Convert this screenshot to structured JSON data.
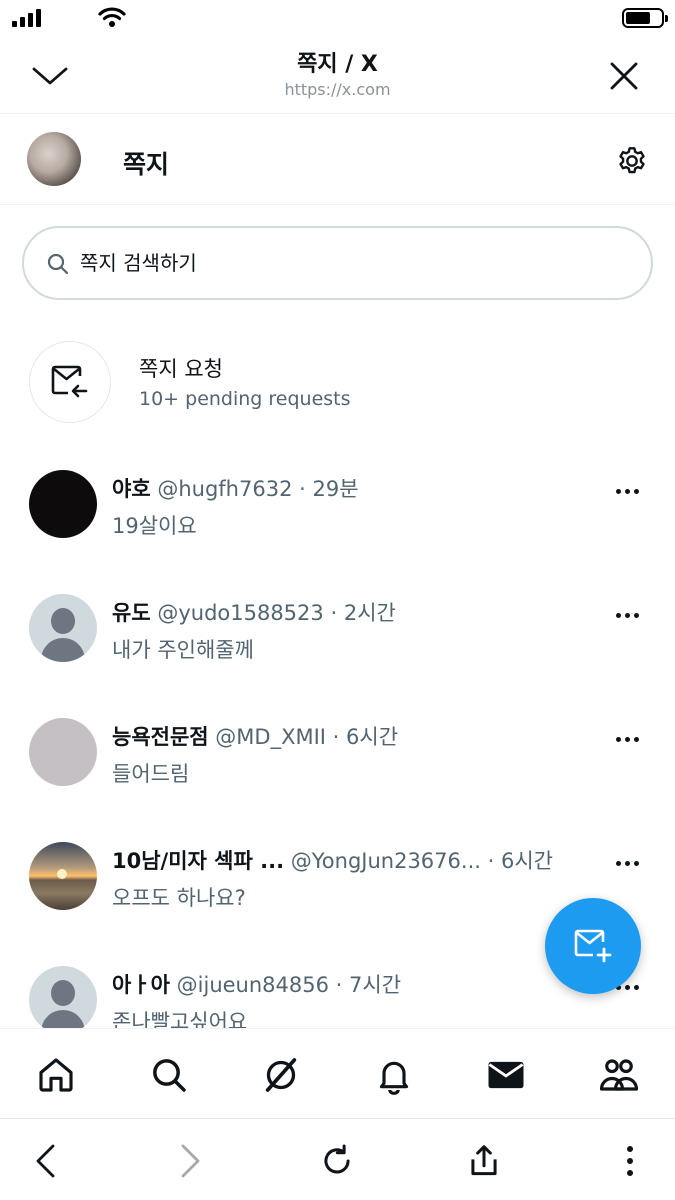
{
  "browser": {
    "title": "쪽지 / X",
    "url": "https://x.com"
  },
  "header": {
    "title": "쪽지"
  },
  "search": {
    "placeholder": "쪽지 검색하기"
  },
  "requests": {
    "title": "쪽지 요청",
    "subtitle": "10+ pending requests"
  },
  "conversations": [
    {
      "name": "야호",
      "handle": "@hugfh7632",
      "time": "29분",
      "preview": "19살이요",
      "avatar": "black"
    },
    {
      "name": "유도",
      "handle": "@yudo1588523",
      "time": "2시간",
      "preview": "내가 주인해줄께",
      "avatar": "default-profile"
    },
    {
      "name": "능욕전문점",
      "handle": "@MD_XMII",
      "time": "6시간",
      "preview": "들어드림",
      "avatar": "gray"
    },
    {
      "name": "10남/미자 섹파 ...",
      "handle": "@YongJun23676...",
      "time": "6시간",
      "preview": "오프도 하나요?",
      "avatar": "sunset"
    },
    {
      "name": "아ㅏ아",
      "handle": "@ijueun84856",
      "time": "7시간",
      "preview": "존나빨고싶어요",
      "avatar": "default-profile"
    }
  ],
  "separator": "·",
  "icons": {
    "status": [
      "signal-icon",
      "wifi-icon",
      "battery-icon"
    ],
    "browser_header": [
      "chevron-down-icon",
      "close-icon"
    ],
    "nav": [
      "home-icon",
      "search-icon",
      "grok-icon",
      "notifications-icon",
      "messages-icon",
      "communities-icon"
    ],
    "toolbar": [
      "back-icon",
      "forward-icon",
      "reload-icon",
      "share-icon",
      "more-icon"
    ]
  },
  "colors": {
    "accent": "#1d9bf0",
    "text_primary": "#0f1419",
    "text_secondary": "#536471",
    "border": "#cfd9de"
  }
}
